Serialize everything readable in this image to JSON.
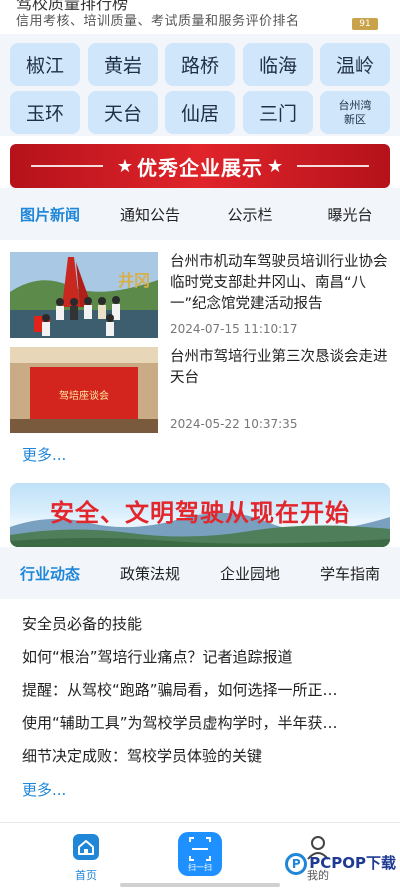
{
  "header": {
    "title": "驾校质量排行榜",
    "subtitle": "信用考核、培训质量、考试质量和服务评价排名",
    "badge": "91"
  },
  "regions": [
    "椒江",
    "黄岩",
    "路桥",
    "临海",
    "温岭",
    "玉环",
    "天台",
    "仙居",
    "三门",
    "台州湾新区"
  ],
  "enterprise_banner": {
    "label": "优秀企业展示"
  },
  "news_tabs": [
    "图片新闻",
    "通知公告",
    "公示栏",
    "曝光台"
  ],
  "news": [
    {
      "title": "台州市机动车驾驶员培训行业协会临时党支部赴井冈山、南昌“八一”纪念馆党建活动报告",
      "date": "2024-07-15 11:10:17"
    },
    {
      "title": "台州市驾培行业第三次恳谈会走进天台",
      "date": "2024-05-22 10:37:35",
      "image_sign": "驾培座谈会"
    }
  ],
  "more_label": "更多...",
  "safety_banner": {
    "text": "安全、文明驾驶从现在开始"
  },
  "industry_tabs": [
    "行业动态",
    "政策法规",
    "企业园地",
    "学车指南"
  ],
  "articles": [
    "安全员必备的技能",
    "如何“根治”驾培行业痛点？记者追踪报道",
    "提醒：从驾校“跑路”骗局看，如何选择一所正…",
    "使用“辅助工具”为驾校学员虚构学时，半年获…",
    "细节决定成败：驾校学员体验的关键"
  ],
  "bottom_nav": {
    "home": "首页",
    "scan": "扫一扫",
    "mine": "我的"
  },
  "watermark": "PCPOP下载",
  "colors": {
    "accent": "#1f86d8",
    "brand_red": "#e0242a",
    "region_bg": "#cfe6fb"
  }
}
